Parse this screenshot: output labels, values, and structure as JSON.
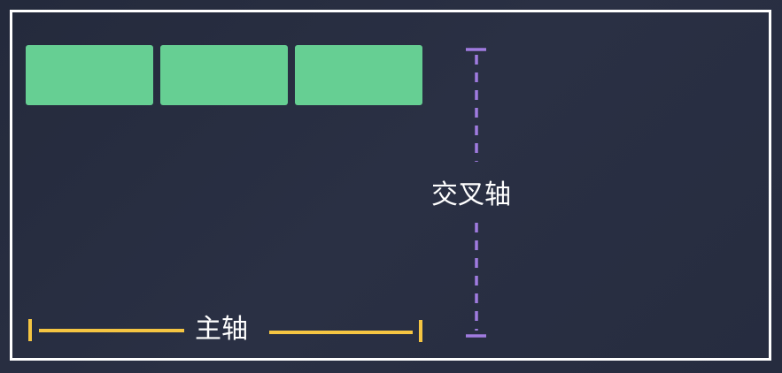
{
  "diagram": {
    "main_axis_label": "主轴",
    "cross_axis_label": "交叉轴",
    "items": [
      {
        "id": "item-1"
      },
      {
        "id": "item-2"
      },
      {
        "id": "item-3"
      }
    ],
    "colors": {
      "background": "#272d40",
      "frame": "#ffffff",
      "item": "#66cf93",
      "main_axis": "#f5c542",
      "cross_axis": "#a07be0",
      "label_text": "#ffffff"
    }
  }
}
